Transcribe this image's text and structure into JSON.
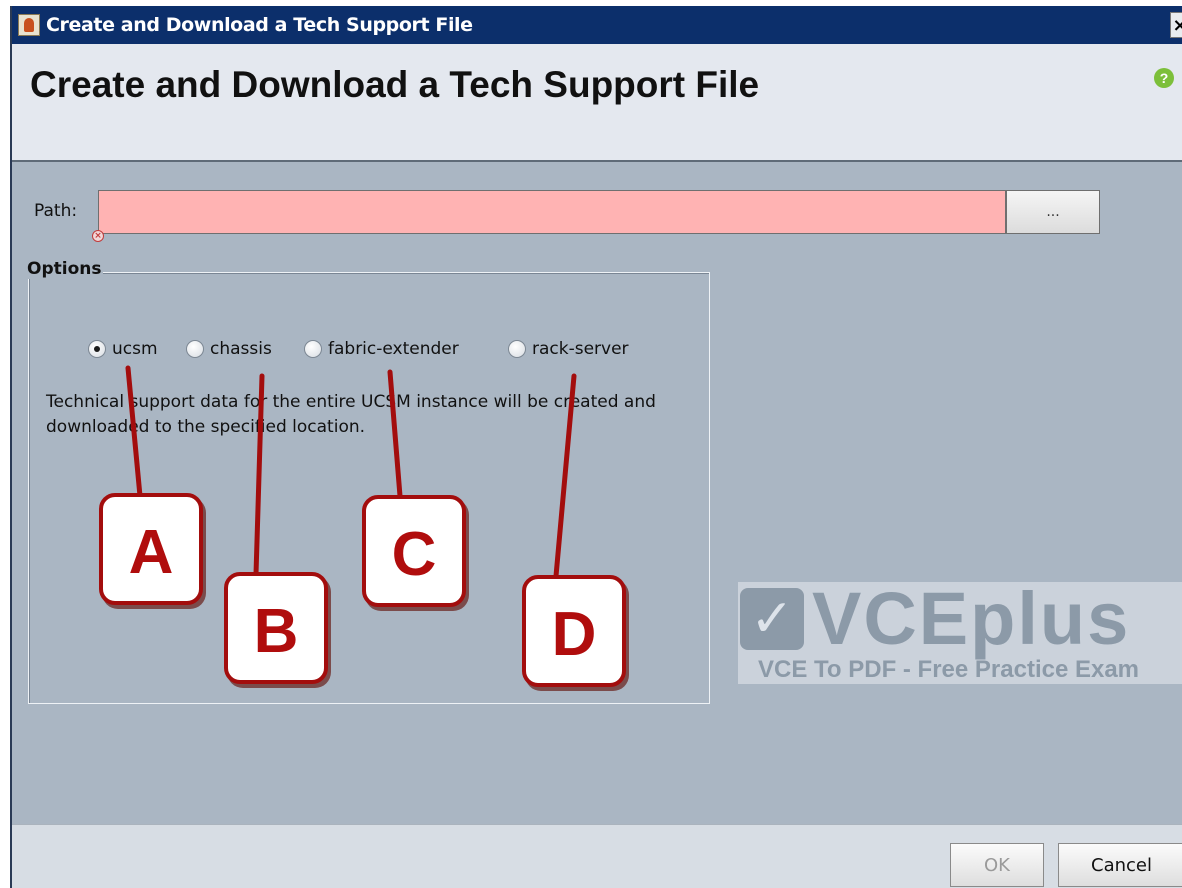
{
  "window": {
    "title": "Create and Download a Tech Support File",
    "close_glyph": "×",
    "app_icon": "java-cup-icon"
  },
  "header": {
    "heading": "Create and Download a Tech Support File",
    "help_glyph": "?",
    "help_icon": "help-icon"
  },
  "path": {
    "label": "Path:",
    "value": "",
    "placeholder": "",
    "browse_label": "...",
    "error_icon": "error-icon",
    "error_color": "#ffb3b3"
  },
  "options": {
    "legend": "Options",
    "items": [
      {
        "label": "ucsm",
        "selected": true
      },
      {
        "label": "chassis",
        "selected": false
      },
      {
        "label": "fabric-extender",
        "selected": false
      },
      {
        "label": "rack-server",
        "selected": false
      }
    ],
    "description": "Technical support data for the entire UCSM instance will be created and downloaded to the specified location."
  },
  "callouts": [
    "A",
    "B",
    "C",
    "D"
  ],
  "watermark": {
    "brand": "VCEplus",
    "tagline": "VCE To PDF - Free Practice Exam"
  },
  "footer": {
    "ok_label": "OK",
    "cancel_label": "Cancel"
  },
  "colors": {
    "titlebar": "#0c2f6b",
    "dialog_body": "#aab6c3",
    "callout_red": "#b00d0d"
  }
}
